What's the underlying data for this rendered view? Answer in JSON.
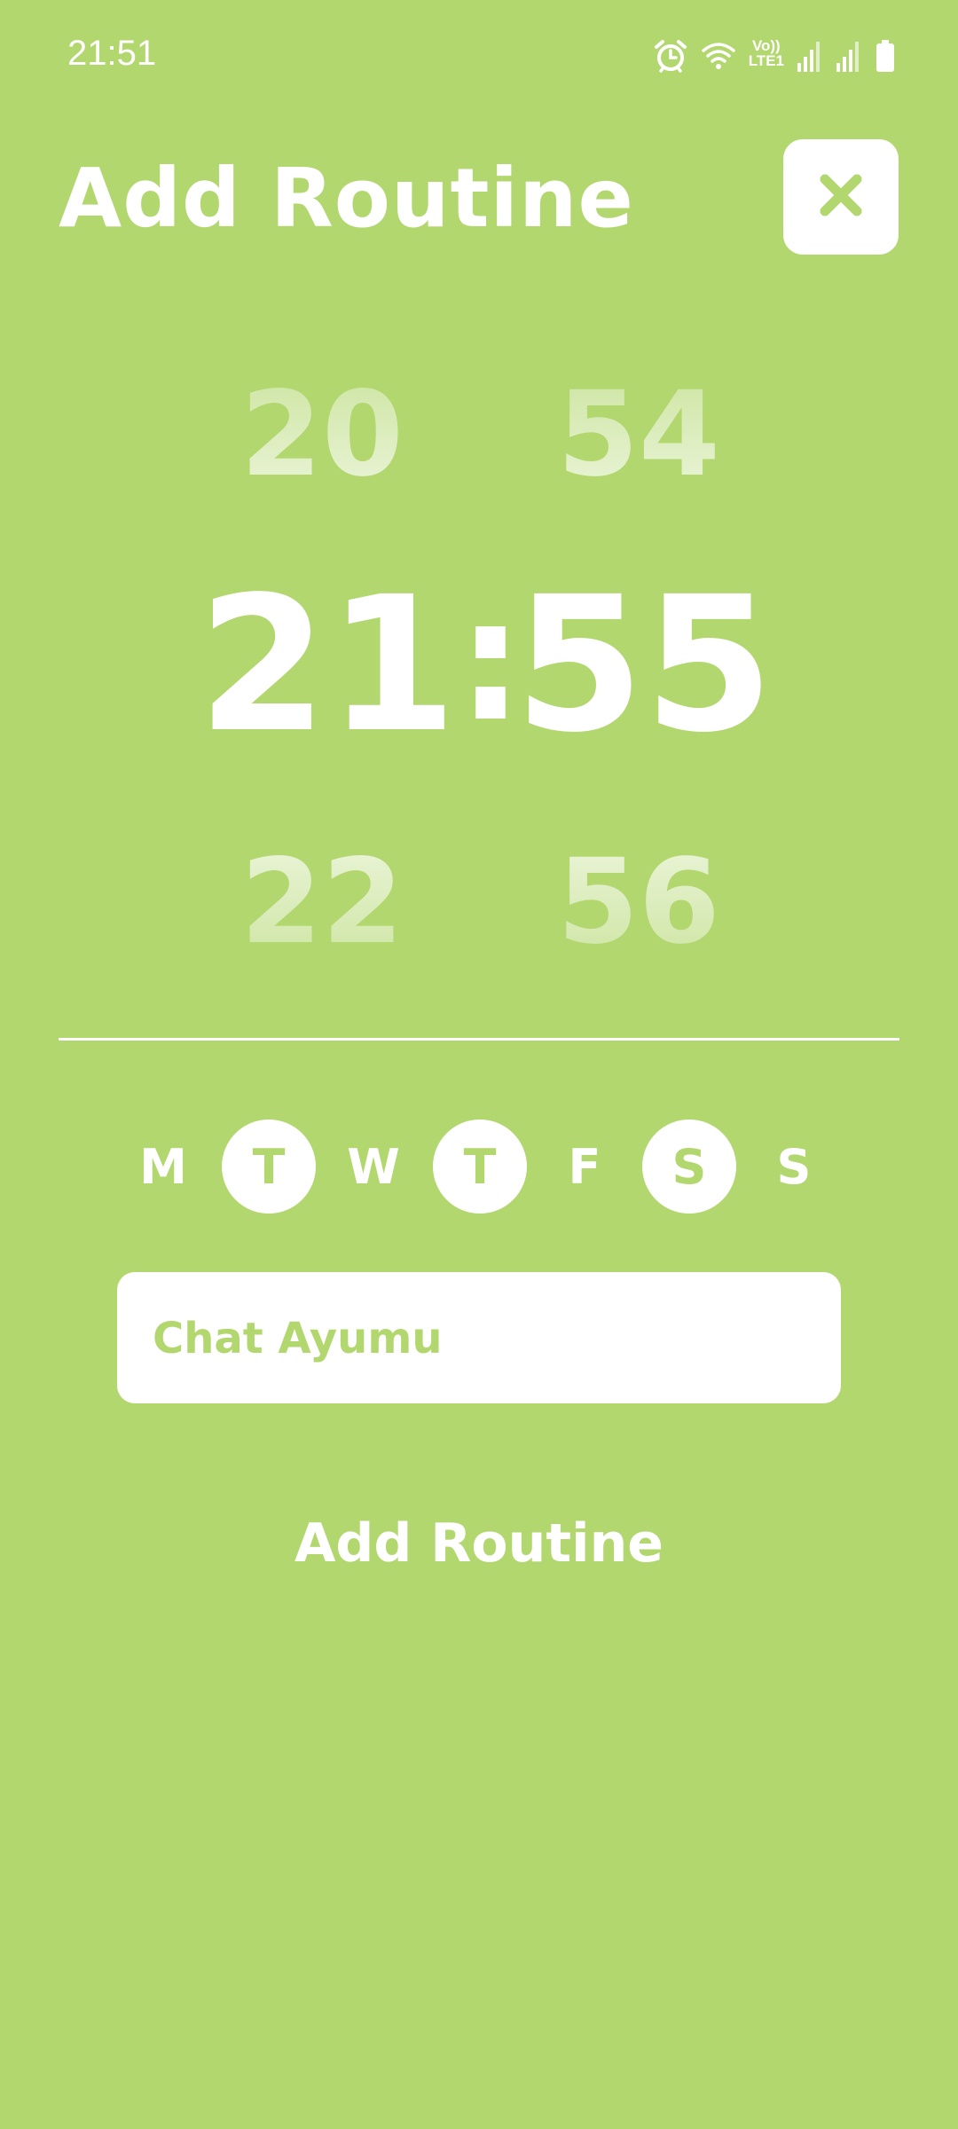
{
  "status_bar": {
    "time": "21:51",
    "volte_line1": "Vo))",
    "volte_line2": "LTE1",
    "icons": [
      "alarm-icon",
      "wifi-icon",
      "volte-icon",
      "signal-icon",
      "signal-icon",
      "battery-icon"
    ]
  },
  "header": {
    "title": "Add Routine",
    "close_icon": "close-icon"
  },
  "time_picker": {
    "hour_prev": "20",
    "hour_selected": "21",
    "hour_next": "22",
    "separator": ":",
    "minute_prev": "54",
    "minute_selected": "55",
    "minute_next": "56"
  },
  "days": [
    {
      "label": "M",
      "selected": false
    },
    {
      "label": "T",
      "selected": true
    },
    {
      "label": "W",
      "selected": false
    },
    {
      "label": "T",
      "selected": true
    },
    {
      "label": "F",
      "selected": false
    },
    {
      "label": "S",
      "selected": true
    },
    {
      "label": "S",
      "selected": false
    }
  ],
  "routine_name": {
    "value": "Chat Ayumu"
  },
  "add_button": {
    "label": "Add Routine"
  },
  "colors": {
    "background": "#b2d76f",
    "foreground": "#ffffff"
  }
}
